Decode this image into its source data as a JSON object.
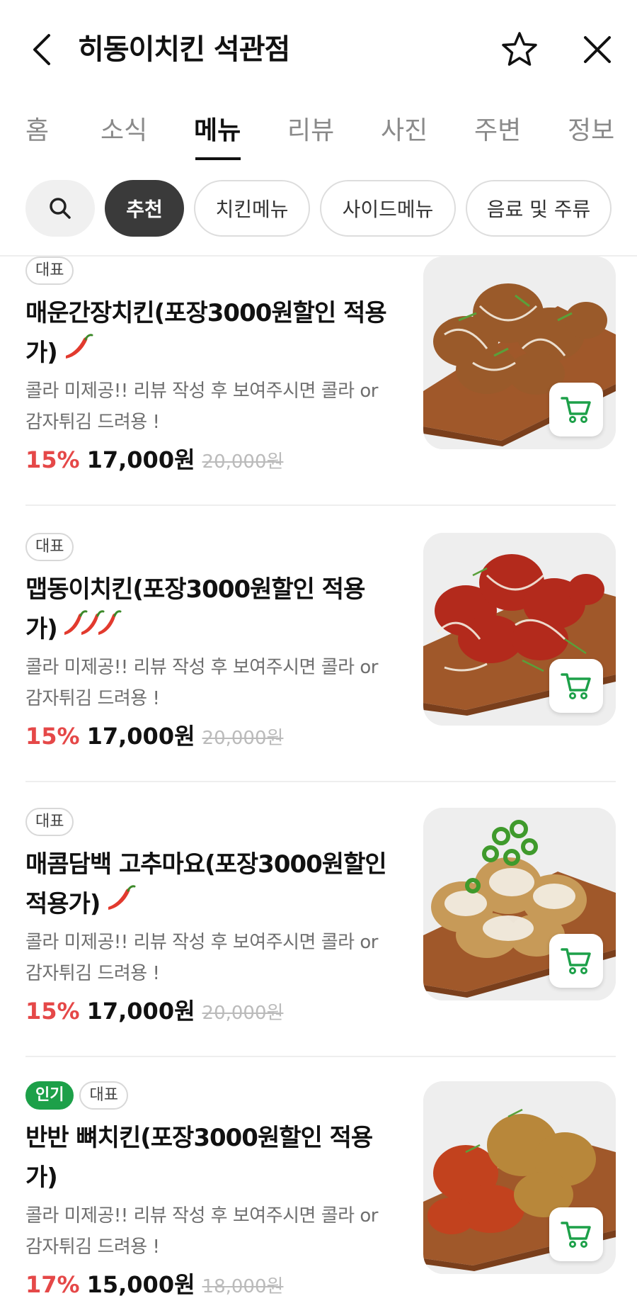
{
  "header": {
    "title": "히동이치킨 석관점",
    "icons": {
      "back": "chevron-left-icon",
      "favorite": "star-outline-icon",
      "close": "close-icon"
    }
  },
  "tabs": [
    {
      "label": "홈",
      "active": false
    },
    {
      "label": "소식",
      "active": false
    },
    {
      "label": "메뉴",
      "active": true
    },
    {
      "label": "리뷰",
      "active": false
    },
    {
      "label": "사진",
      "active": false
    },
    {
      "label": "주변",
      "active": false
    },
    {
      "label": "정보",
      "active": false
    }
  ],
  "chips": {
    "search_icon": "search-icon",
    "items": [
      {
        "label": "추천",
        "active": true
      },
      {
        "label": "치킨메뉴",
        "active": false
      },
      {
        "label": "사이드메뉴",
        "active": false
      },
      {
        "label": "음료 및 주류",
        "active": false
      }
    ]
  },
  "colors": {
    "accent_green": "#1da049",
    "discount_red": "#e54848",
    "active_chip": "#3a3a3a"
  },
  "menu_items": [
    {
      "badges": [
        "대표"
      ],
      "name": "매운간장치킨(포장3000원할인 적용가)",
      "spice_level": 1,
      "description": "콜라 미제공!! 리뷰 작성 후 보여주시면 콜라 or 감자튀김 드려용 !",
      "discount": "15%",
      "price": "17,000원",
      "original_price": "20,000원"
    },
    {
      "badges": [
        "대표"
      ],
      "name": "맵동이치킨(포장3000원할인 적용가)",
      "spice_level": 3,
      "description": "콜라 미제공!! 리뷰 작성 후 보여주시면 콜라 or 감자튀김 드려용 !",
      "discount": "15%",
      "price": "17,000원",
      "original_price": "20,000원"
    },
    {
      "badges": [
        "대표"
      ],
      "name": "매콤담백 고추마요(포장3000원할인 적용가)",
      "spice_level": 1,
      "description": "콜라 미제공!! 리뷰 작성 후 보여주시면 콜라 or 감자튀김 드려용 !",
      "discount": "15%",
      "price": "17,000원",
      "original_price": "20,000원"
    },
    {
      "badges": [
        "인기",
        "대표"
      ],
      "name": "반반 뼈치킨(포장3000원할인 적용가)",
      "spice_level": 0,
      "description": "콜라 미제공!! 리뷰 작성 후 보여주시면 콜라 or 감자튀김 드려용 !",
      "discount": "17%",
      "price": "15,000원",
      "original_price": "18,000원"
    }
  ]
}
